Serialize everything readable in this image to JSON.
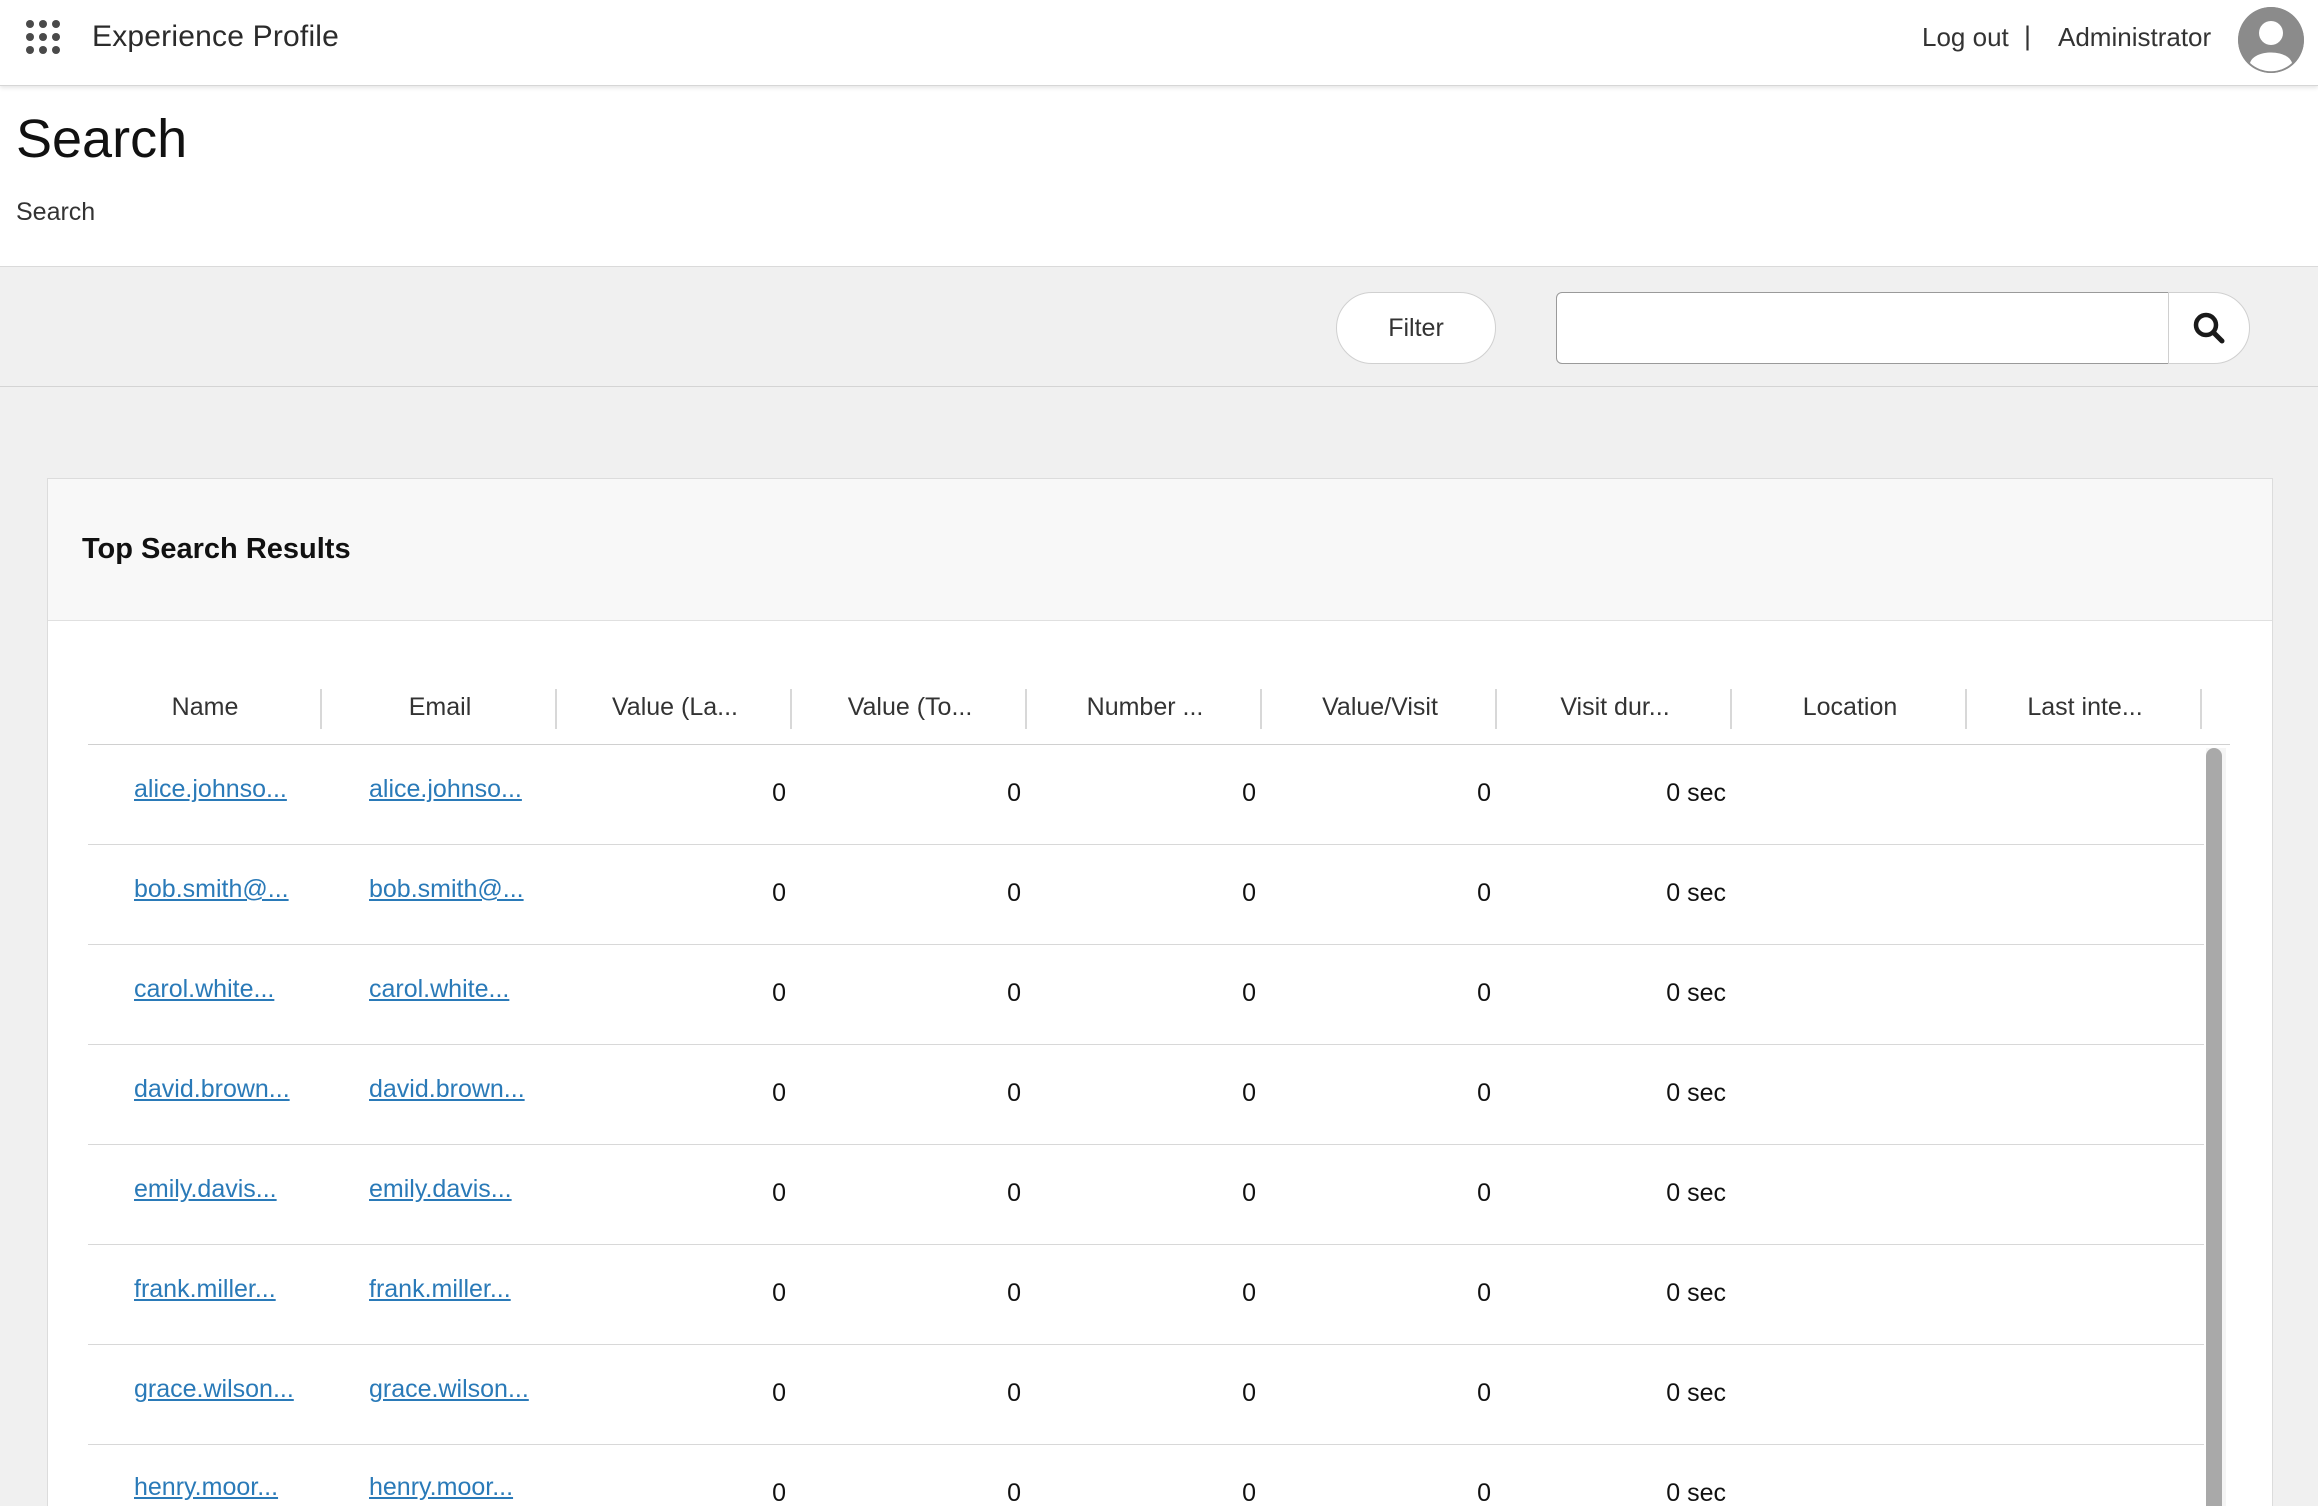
{
  "header": {
    "app_title": "Experience Profile",
    "logout_label": "Log out",
    "separator": "|",
    "user_name": "Administrator"
  },
  "page": {
    "title": "Search",
    "breadcrumb": "Search"
  },
  "toolbar": {
    "filter_label": "Filter",
    "search_value": "",
    "search_placeholder": ""
  },
  "results": {
    "title": "Top Search Results",
    "columns": [
      "Name",
      "Email",
      "Value (La...",
      "Value (To...",
      "Number ...",
      "Value/Visit",
      "Visit dur...",
      "Location",
      "Last inte..."
    ],
    "rows": [
      {
        "name": "alice.johnso...",
        "email": "alice.johnso...",
        "value_last": "0",
        "value_total": "0",
        "number": "0",
        "value_visit": "0",
        "visit_duration": "0 sec",
        "location": "",
        "last_interaction": ""
      },
      {
        "name": "bob.smith@...",
        "email": "bob.smith@...",
        "value_last": "0",
        "value_total": "0",
        "number": "0",
        "value_visit": "0",
        "visit_duration": "0 sec",
        "location": "",
        "last_interaction": ""
      },
      {
        "name": "carol.white...",
        "email": "carol.white...",
        "value_last": "0",
        "value_total": "0",
        "number": "0",
        "value_visit": "0",
        "visit_duration": "0 sec",
        "location": "",
        "last_interaction": ""
      },
      {
        "name": "david.brown...",
        "email": "david.brown...",
        "value_last": "0",
        "value_total": "0",
        "number": "0",
        "value_visit": "0",
        "visit_duration": "0 sec",
        "location": "",
        "last_interaction": ""
      },
      {
        "name": "emily.davis...",
        "email": "emily.davis...",
        "value_last": "0",
        "value_total": "0",
        "number": "0",
        "value_visit": "0",
        "visit_duration": "0 sec",
        "location": "",
        "last_interaction": ""
      },
      {
        "name": "frank.miller...",
        "email": "frank.miller...",
        "value_last": "0",
        "value_total": "0",
        "number": "0",
        "value_visit": "0",
        "visit_duration": "0 sec",
        "location": "",
        "last_interaction": ""
      },
      {
        "name": "grace.wilson...",
        "email": "grace.wilson...",
        "value_last": "0",
        "value_total": "0",
        "number": "0",
        "value_visit": "0",
        "visit_duration": "0 sec",
        "location": "",
        "last_interaction": ""
      },
      {
        "name": "henry.moor...",
        "email": "henry.moor...",
        "value_last": "0",
        "value_total": "0",
        "number": "0",
        "value_visit": "0",
        "visit_duration": "0 sec",
        "location": "",
        "last_interaction": ""
      }
    ]
  },
  "icons": {
    "apps": "apps-grid-icon",
    "search": "search-icon",
    "avatar": "user-avatar-icon"
  },
  "colors": {
    "link": "#2a7ab8",
    "toolbar_bg": "#f0f0f0",
    "card_header_bg": "#f8f8f8",
    "avatar_gray": "#8b8b8b"
  }
}
